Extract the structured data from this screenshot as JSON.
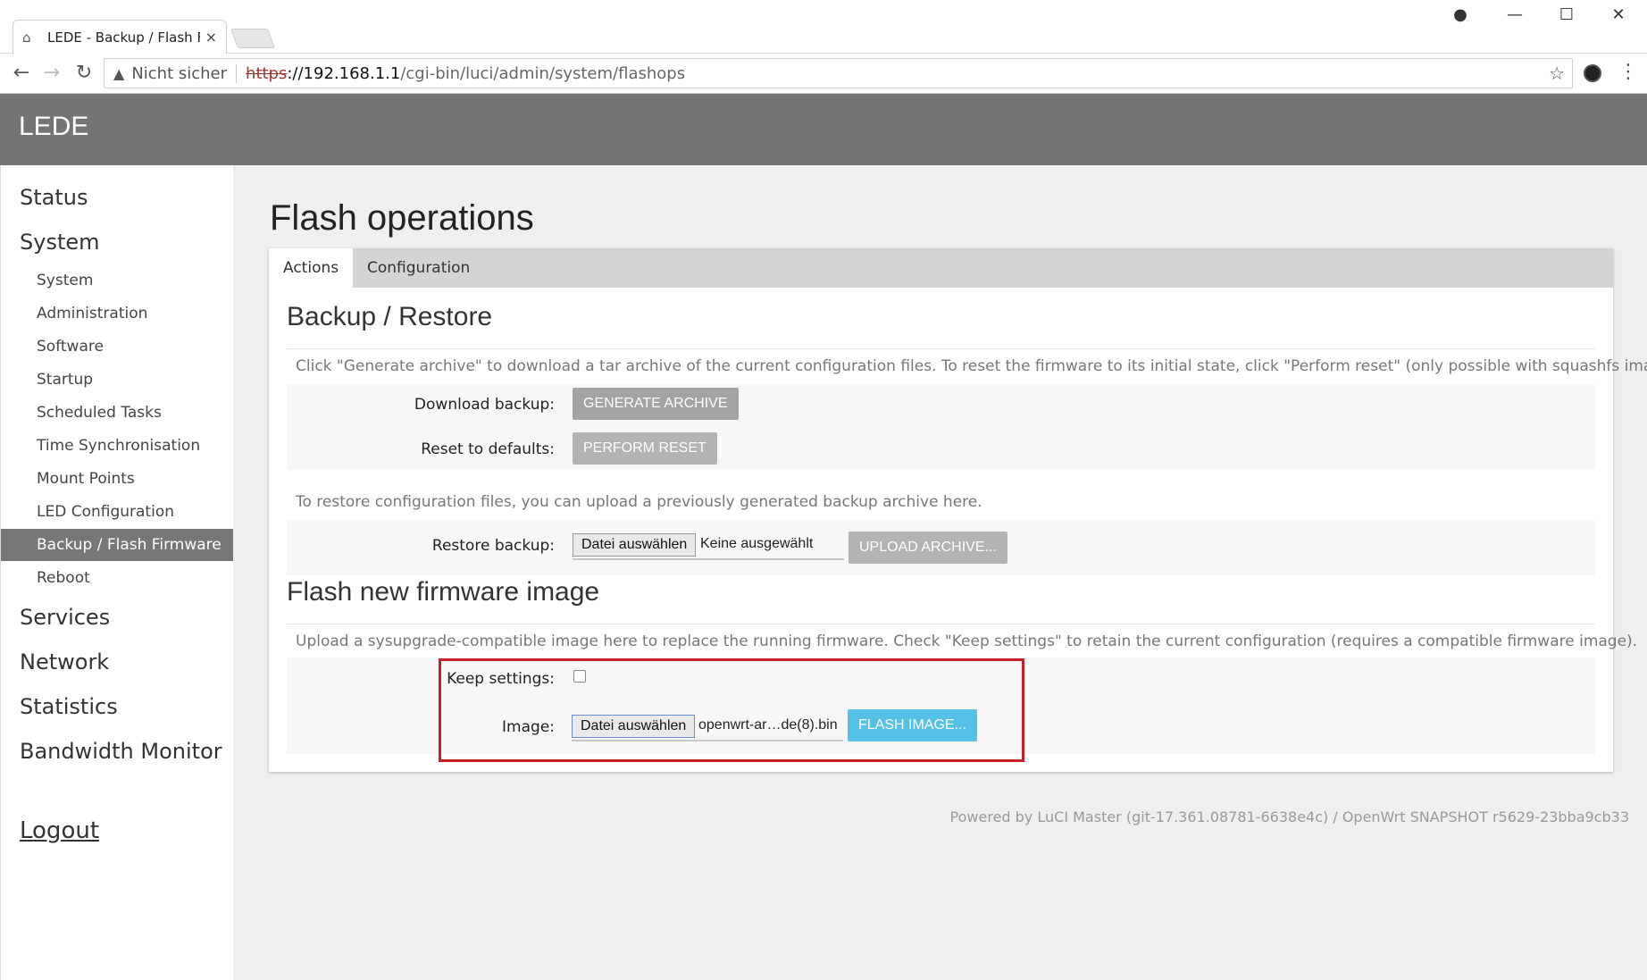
{
  "browser": {
    "tab_title": "LEDE - Backup / Flash Fir",
    "tab_close": "×",
    "security_warning_icon": "warning-triangle-icon",
    "security_label": "Nicht sicher",
    "url_scheme": "https",
    "url_host": "://192.168.1.1",
    "url_path": "/cgi-bin/luci/admin/system/flashops"
  },
  "app": {
    "brand": "LEDE"
  },
  "sidebar": {
    "top_items": [
      "Status",
      "System",
      "Services",
      "Network",
      "Statistics",
      "Bandwidth Monitor"
    ],
    "sub_items": [
      "System",
      "Administration",
      "Software",
      "Startup",
      "Scheduled Tasks",
      "Time Synchronisation",
      "Mount Points",
      "LED Configuration",
      "Backup / Flash Firmware",
      "Reboot"
    ],
    "active_sub": "Backup / Flash Firmware",
    "logout": "Logout"
  },
  "main": {
    "title": "Flash operations",
    "tabs": [
      "Actions",
      "Configuration"
    ],
    "active_tab": "Actions",
    "backup": {
      "title": "Backup / Restore",
      "description": "Click \"Generate archive\" to download a tar archive of the current configuration files. To reset the firmware to its initial state, click \"Perform reset\" (only possible with squashfs images).",
      "download_label": "Download backup:",
      "generate_button": "GENERATE ARCHIVE",
      "reset_label": "Reset to defaults:",
      "reset_button": "PERFORM RESET",
      "restore_description": "To restore configuration files, you can upload a previously generated backup archive here.",
      "restore_label": "Restore backup:",
      "file_choose": "Datei auswählen",
      "file_none": "Keine ausgewählt",
      "upload_button": "UPLOAD ARCHIVE..."
    },
    "flash": {
      "title": "Flash new firmware image",
      "description": "Upload a sysupgrade-compatible image here to replace the running firmware. Check \"Keep settings\" to retain the current configuration (requires a compatible firmware image).",
      "keep_label": "Keep settings:",
      "keep_checked": false,
      "image_label": "Image:",
      "file_choose": "Datei auswählen",
      "file_name": "openwrt-ar…de(8).bin",
      "flash_button": "FLASH IMAGE..."
    }
  },
  "footer": "Powered by LuCI Master (git-17.361.08781-6638e4c) / OpenWrt SNAPSHOT r5629-23bba9cb33",
  "colors": {
    "header_bg": "#747474",
    "active_nav": "#777777",
    "flash_button": "#55c1e6",
    "highlight_box": "#c8202a"
  }
}
